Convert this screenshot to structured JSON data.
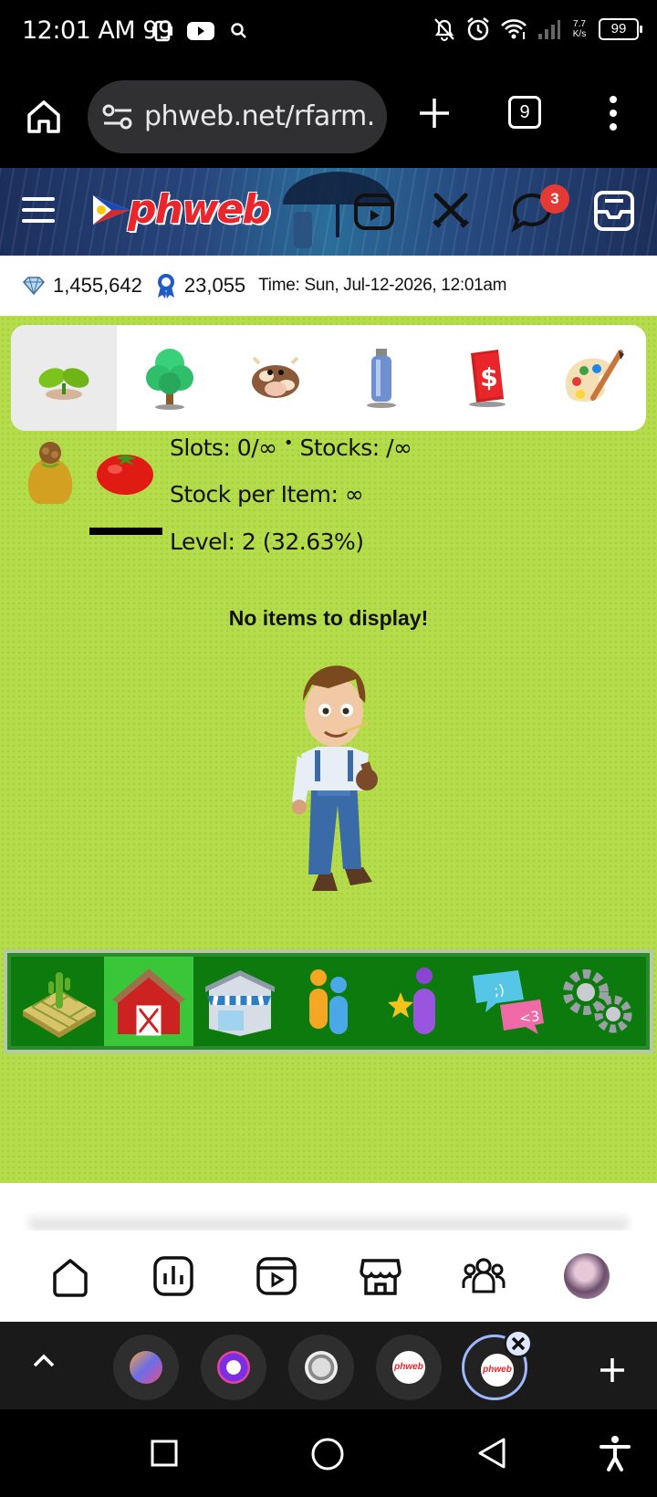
{
  "status_bar": {
    "time": "12:01 AM",
    "notification_count": "99",
    "net_speed_value": "7.7",
    "net_speed_unit": "K/s",
    "battery": "99"
  },
  "browser": {
    "url": "phweb.net/rfarm.",
    "tab_count": "9"
  },
  "site": {
    "logo_text": "phweb",
    "chat_badge": "3"
  },
  "info": {
    "gems": "1,455,642",
    "ribbons": "23,055",
    "time": "Time: Sun, Jul-12-2026, 12:01am"
  },
  "farm": {
    "categories": [
      "seeds",
      "trees",
      "animals",
      "tools",
      "money",
      "decor"
    ],
    "slots": "Slots: 0/∞",
    "stocks": "Stocks: /∞",
    "stock_per_item": "Stock per Item: ∞",
    "level": "Level: 2 (32.63%)",
    "empty_message": "No items to display!",
    "toolbar": [
      "farm",
      "barn",
      "shop",
      "neighbors",
      "achievements",
      "chat",
      "settings"
    ]
  },
  "colors": {
    "grass": "#b5dc4a",
    "toolbar_green": "#0d7a0d",
    "toolbar_active": "#39c739",
    "accent_red": "#e53935"
  }
}
